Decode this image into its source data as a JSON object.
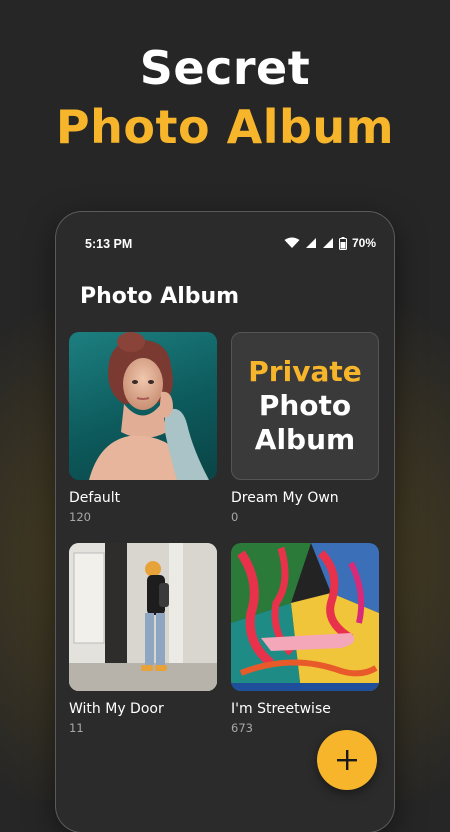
{
  "promo": {
    "line1": "Secret",
    "line2": "Photo Album",
    "accent_color": "#f6b52a"
  },
  "status_bar": {
    "time": "5:13 PM",
    "battery": "70%",
    "icons": [
      "wifi-icon",
      "signal-icon",
      "signal-icon",
      "battery-icon"
    ]
  },
  "app": {
    "title": "Photo Album"
  },
  "albums": [
    {
      "name": "Default",
      "count": "120",
      "thumb": "portrait-photo"
    },
    {
      "name": "Dream My Own",
      "count": "0",
      "thumb": "private-placeholder",
      "placeholder_lines": [
        "Private",
        "Photo",
        "Album"
      ]
    },
    {
      "name": "With My Door",
      "count": "11",
      "thumb": "street-photo"
    },
    {
      "name": "I'm Streetwise",
      "count": "673",
      "thumb": "abstract-art"
    }
  ],
  "fab": {
    "icon": "plus-icon",
    "color": "#f6b52a"
  }
}
